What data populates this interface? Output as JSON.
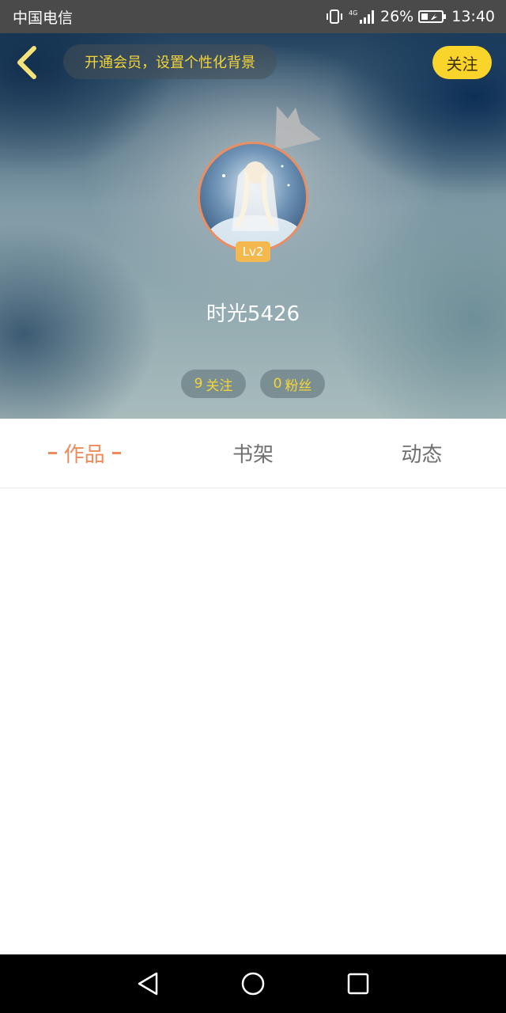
{
  "status_bar": {
    "carrier": "中国电信",
    "network": "4G",
    "battery": "26%",
    "time": "13:40"
  },
  "header": {
    "back_icon": "chevron-left-icon",
    "vip_prompt": "开通会员，设置个性化背景",
    "follow_label": "关注",
    "level": "Lv2",
    "username": "时光5426",
    "stats": {
      "following": {
        "count": "9",
        "label": "关注"
      },
      "fans": {
        "count": "0",
        "label": "粉丝"
      }
    },
    "accent_color": "#f9d42a"
  },
  "tabs": [
    {
      "label": "作品",
      "active": true
    },
    {
      "label": "书架",
      "active": false
    },
    {
      "label": "动态",
      "active": false
    }
  ],
  "tab_active_color": "#ef8b5b",
  "nav_bar": {
    "back_icon": "triangle-back-icon",
    "home_icon": "circle-home-icon",
    "recents_icon": "square-recents-icon"
  }
}
